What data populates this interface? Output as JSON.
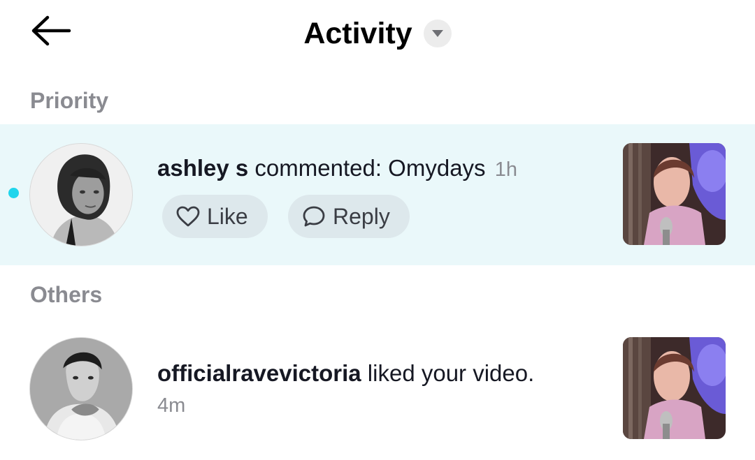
{
  "header": {
    "title": "Activity",
    "back_icon": "arrow-left-icon",
    "dropdown_icon": "caret-down-icon"
  },
  "sections": {
    "priority": {
      "label": "Priority"
    },
    "others": {
      "label": "Others"
    }
  },
  "notifications": [
    {
      "username": "ashley s",
      "action": " commented: Omydays",
      "time": "1h",
      "unread": true,
      "actions": {
        "like_label": "Like",
        "reply_label": "Reply"
      },
      "icons": {
        "like": "heart-icon",
        "reply": "comment-bubble-icon"
      }
    },
    {
      "username": "officialravevictoria",
      "action": " liked your video.",
      "time": "4m",
      "unread": false
    }
  ],
  "colors": {
    "highlight_bg": "#eaf8fa",
    "unread_dot": "#20d5ec",
    "secondary_text": "#8a8b91",
    "action_button_bg": "#dde8ec"
  }
}
